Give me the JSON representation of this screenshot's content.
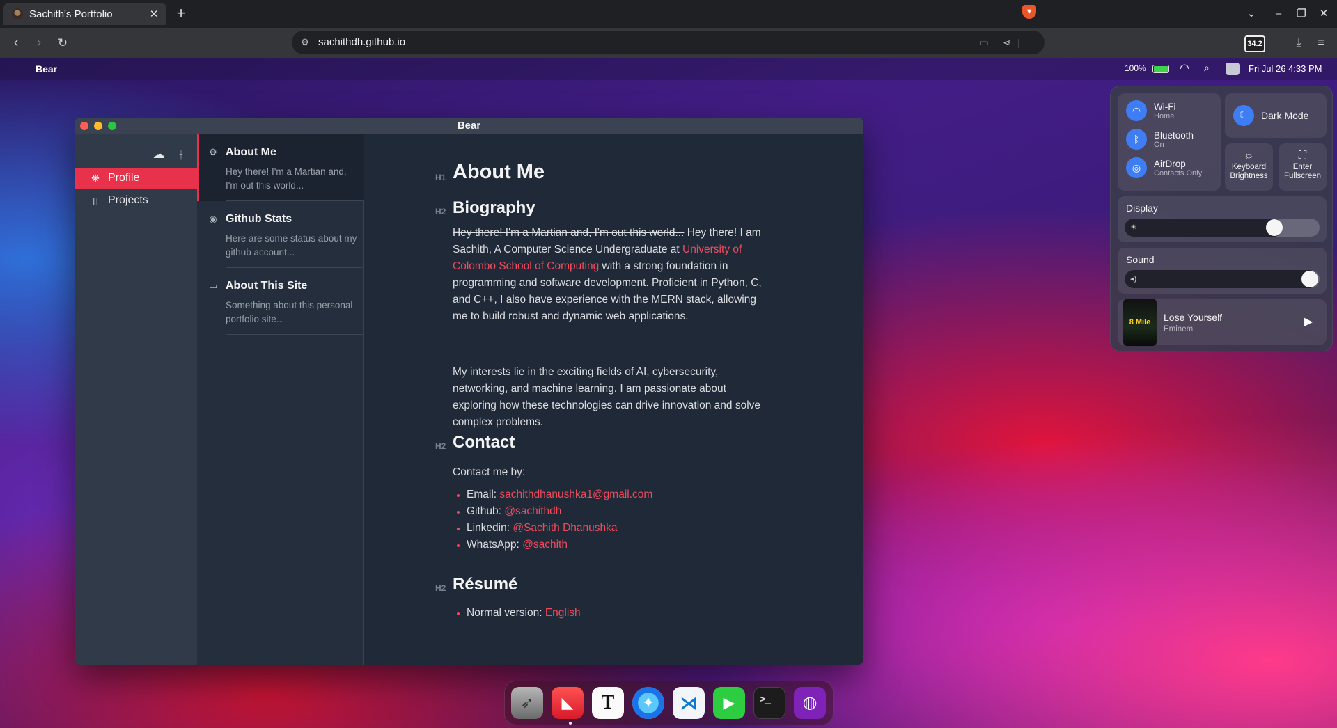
{
  "browser": {
    "tab_title": "Sachith's Portfolio",
    "tab_close": "✕",
    "new_tab": "+",
    "url": "sachithdh.github.io",
    "extension_badge": "34.2"
  },
  "menubar": {
    "app_name": "Bear",
    "battery_percent": "100%",
    "battery_level": 1.0,
    "datetime": "Fri Jul 26 4:33 PM"
  },
  "bear": {
    "window_title": "Bear",
    "sidebar": {
      "items": [
        {
          "label": "Profile",
          "icon": "paw-icon",
          "active": true
        },
        {
          "label": "Projects",
          "icon": "notebook-icon",
          "active": false
        }
      ]
    },
    "notes": [
      {
        "title": "About Me",
        "snippet": "Hey there! I'm a Martian and, I'm out this world...",
        "icon": "settings-icon"
      },
      {
        "title": "Github Stats",
        "snippet": "Here are some status about my github account...",
        "icon": "github-icon"
      },
      {
        "title": "About This Site",
        "snippet": "Something about this personal portfolio site...",
        "icon": "window-icon"
      }
    ],
    "editor": {
      "h1_tag": "H1",
      "h1": "About Me",
      "biography_tag": "H2",
      "biography_heading": "Biography",
      "bio_strike": "Hey there! I'm a Martian and, I'm out this world...",
      "bio_text1": " Hey there! I am Sachith, A Computer Science Undergraduate at ",
      "bio_link": "University of Colombo School of Computing",
      "bio_text2": " with a strong foundation in programming and software development. Proficient in Python, C, and C++, I also have experience with the MERN stack, allowing me to build robust and dynamic web applications.",
      "interests": "My interests lie in the exciting fields of AI, cybersecurity, networking, and machine learning. I am passionate about exploring how these technologies can drive innovation and solve complex problems.",
      "contact_tag": "H2",
      "contact_heading": "Contact",
      "contact_intro": "Contact me by:",
      "contacts": [
        {
          "label": "Email: ",
          "value": "sachithdhanushka1@gmail.com"
        },
        {
          "label": "Github: ",
          "value": "@sachithdh"
        },
        {
          "label": "Linkedin: ",
          "value": "@Sachith Dhanushka"
        },
        {
          "label": "WhatsApp: ",
          "value": "@sachith"
        }
      ],
      "resume_tag": "H2",
      "resume_heading": "Résumé",
      "resume_label": "Normal version: ",
      "resume_link": "English"
    }
  },
  "control_center": {
    "wifi": {
      "label": "Wi-Fi",
      "status": "Home"
    },
    "bluetooth": {
      "label": "Bluetooth",
      "status": "On"
    },
    "airdrop": {
      "label": "AirDrop",
      "status": "Contacts Only"
    },
    "dark_mode": "Dark Mode",
    "keyboard_brightness_1": "Keyboard",
    "keyboard_brightness_2": "Brightness",
    "fullscreen_1": "Enter",
    "fullscreen_2": "Fullscreen",
    "display": {
      "label": "Display",
      "level": 0.8
    },
    "sound": {
      "label": "Sound",
      "level": 1.0
    },
    "now_playing": {
      "title": "Lose Yourself",
      "artist": "Eminem",
      "album_art_text": "8 Mile"
    }
  },
  "dock": {
    "apps": [
      "launchpad-icon",
      "bear-icon",
      "typora-icon",
      "safari-icon",
      "vscode-icon",
      "facetime-icon",
      "terminal-icon",
      "github-icon"
    ],
    "typora_letter": "T",
    "terminal_prompt": ">_"
  }
}
